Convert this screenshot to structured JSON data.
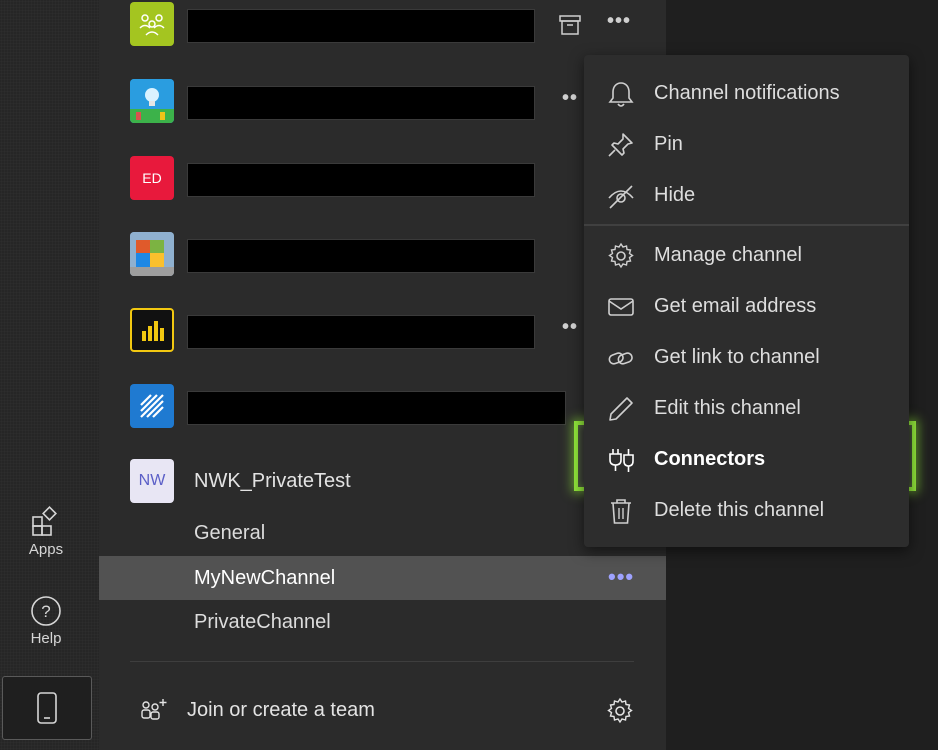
{
  "rail": {
    "apps_label": "Apps",
    "help_label": "Help"
  },
  "teams": [
    {
      "avatar_text": "",
      "color": "#a4c520",
      "has_archive_icon": true
    },
    {
      "avatar_text": "",
      "color": "#1d86c8"
    },
    {
      "avatar_text": "ED",
      "color": "#e8193c"
    },
    {
      "avatar_text": "",
      "color": "#6a8fb5"
    },
    {
      "avatar_text": "",
      "color": "#111111"
    },
    {
      "avatar_text": "",
      "color": "#1f7ad1"
    }
  ],
  "current_team": {
    "avatar_text": "NW",
    "name": "NWK_PrivateTest",
    "channels": [
      "General",
      "MyNewChannel",
      "PrivateChannel"
    ],
    "active_channel_index": 1
  },
  "join_team_label": "Join or create a team",
  "context_menu": {
    "items": [
      {
        "label": "Channel notifications",
        "icon": "bell-icon"
      },
      {
        "label": "Pin",
        "icon": "pin-icon"
      },
      {
        "label": "Hide",
        "icon": "eye-off-icon"
      },
      {
        "label": "Manage channel",
        "icon": "gear-icon"
      },
      {
        "label": "Get email address",
        "icon": "mail-icon"
      },
      {
        "label": "Get link to channel",
        "icon": "link-icon"
      },
      {
        "label": "Edit this channel",
        "icon": "pencil-icon"
      },
      {
        "label": "Connectors",
        "icon": "plug-icon",
        "highlighted": true
      },
      {
        "label": "Delete this channel",
        "icon": "trash-icon"
      }
    ]
  },
  "colors": {
    "highlight": "#8fe33a",
    "accent": "#9ea2ff"
  }
}
